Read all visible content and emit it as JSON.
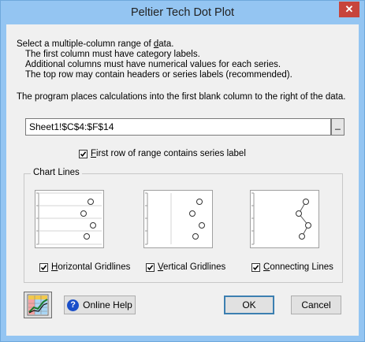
{
  "window": {
    "title": "Peltier Tech Dot Plot",
    "close_glyph": "✕"
  },
  "instructions": {
    "line1": "Select a multiple-column range of data.",
    "line2": "The first column must have category labels.",
    "line3": "Additional  columns must have numerical values for each series.",
    "line4": "The top row may contain headers or series labels (recommended).",
    "line5": "The program places calculations into the first blank column to the right of the data."
  },
  "range_input": {
    "value": "Sheet1!$C$4:$F$14",
    "button_glyph": "_"
  },
  "first_row_checkbox": {
    "label": "First row of range contains series label",
    "checked": true
  },
  "chart_lines": {
    "legend": "Chart Lines",
    "options": [
      {
        "label": "Horizontal Gridlines",
        "checked": true
      },
      {
        "label": "Vertical Gridlines",
        "checked": true
      },
      {
        "label": "Connecting Lines",
        "checked": true
      }
    ]
  },
  "buttons": {
    "help_label": "Online Help",
    "help_icon": "help-icon",
    "ok_label": "OK",
    "cancel_label": "Cancel",
    "logo_icon": "chart-logo-icon"
  },
  "colors": {
    "title_bar": "#94c5f2",
    "close_button": "#c7443c",
    "dialog_bg": "#f0f0f0",
    "default_button_border": "#3c7fb1",
    "help_icon": "#1a4fc9"
  }
}
